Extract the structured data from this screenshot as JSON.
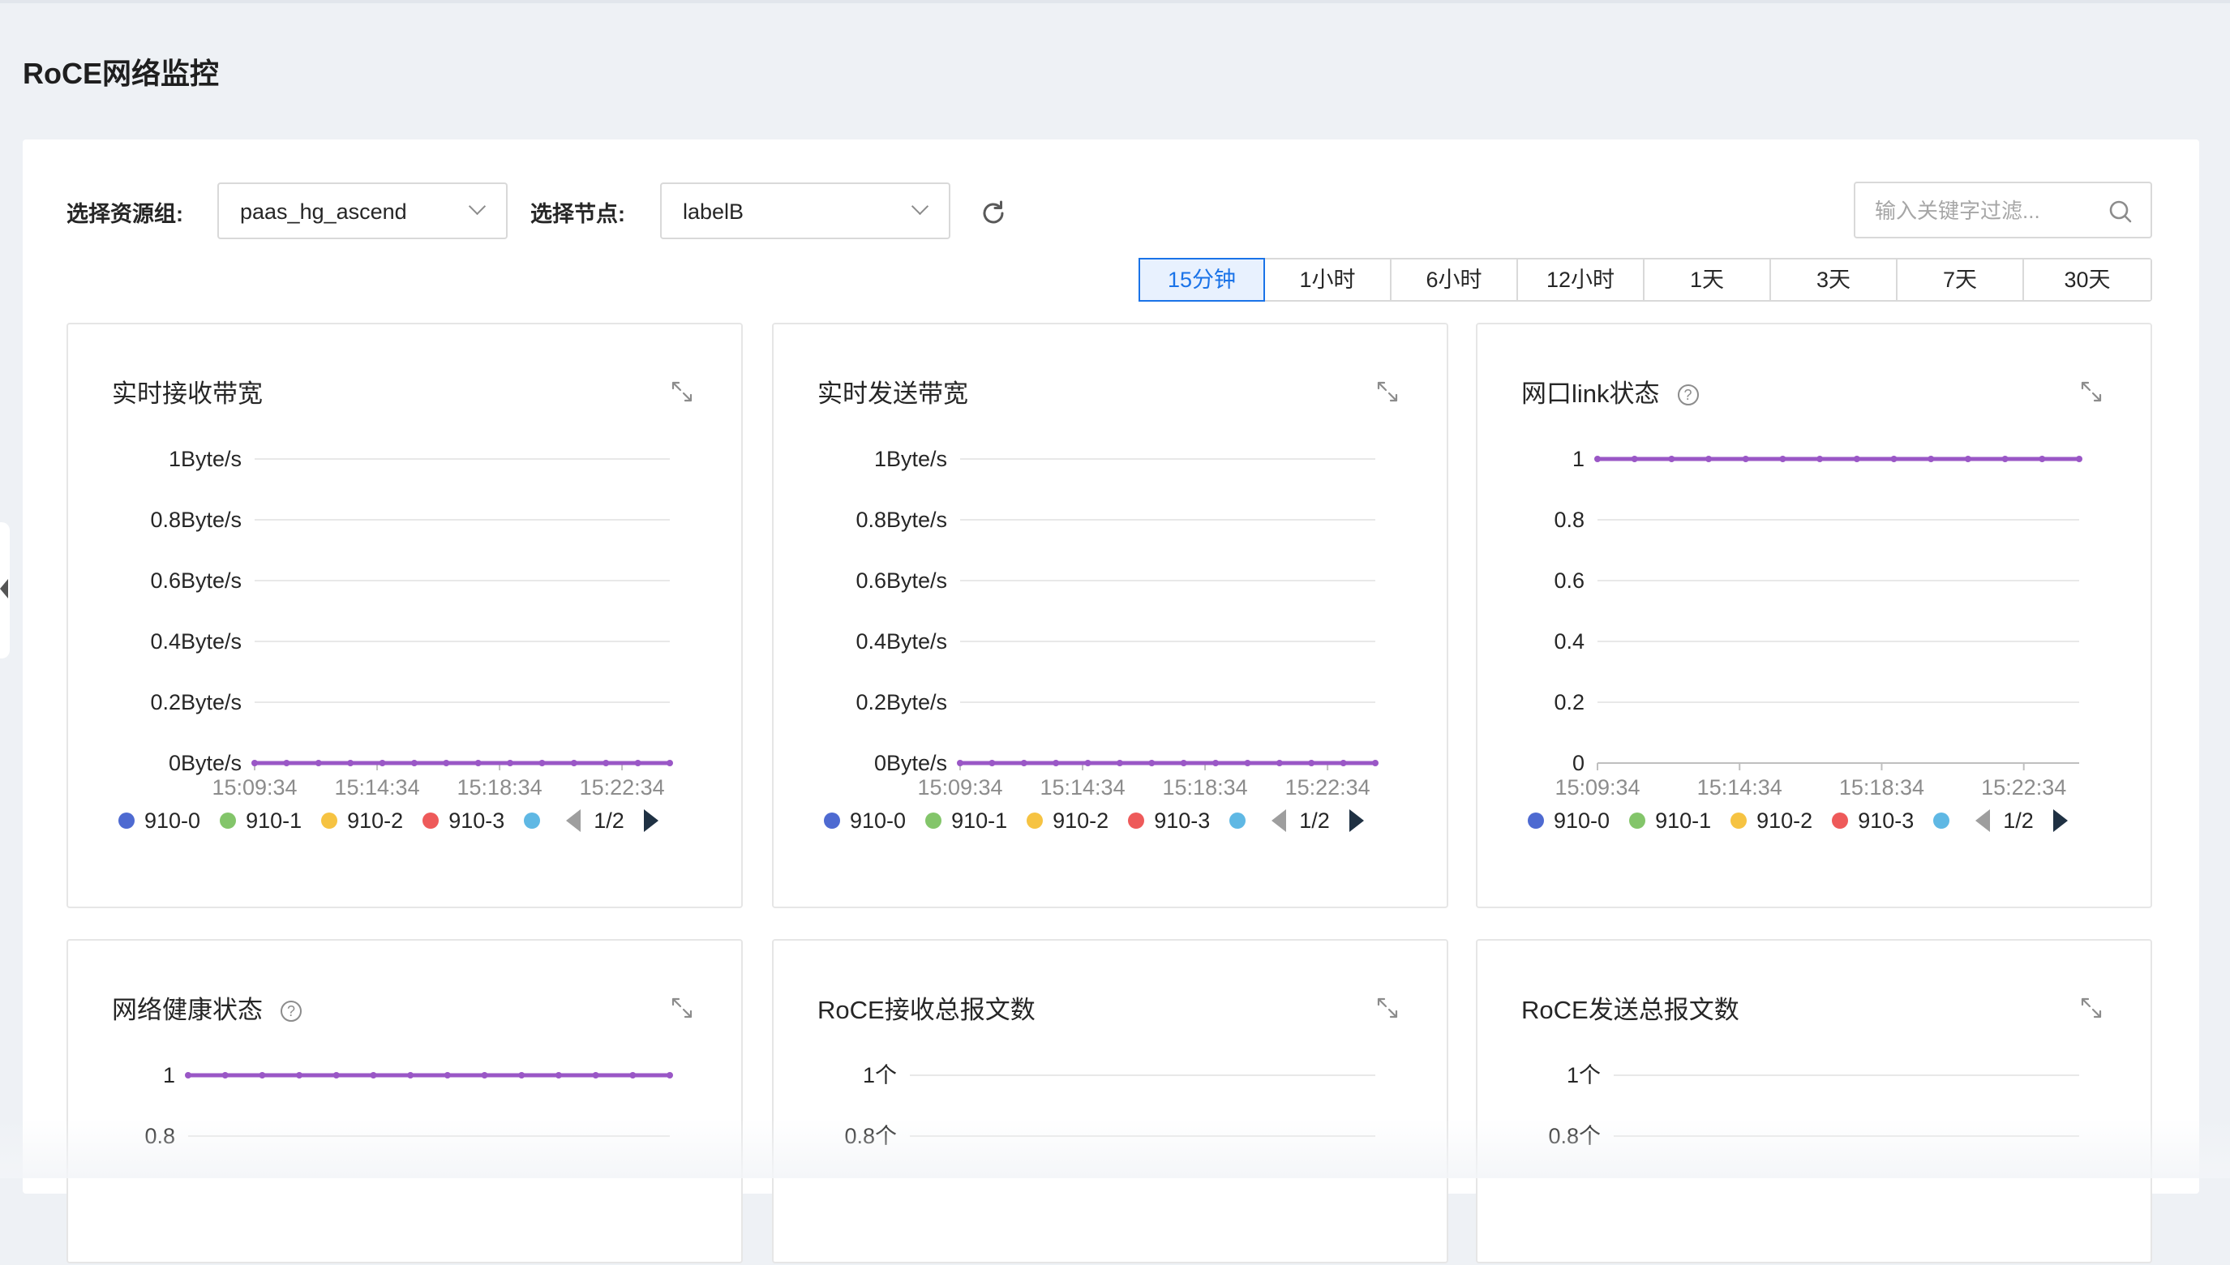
{
  "page": {
    "title": "RoCE网络监控"
  },
  "filters": {
    "resource_group_label": "选择资源组:",
    "resource_group_value": "paas_hg_ascend",
    "node_label": "选择节点:",
    "node_value": "labelB",
    "search_placeholder": "输入关键字过滤..."
  },
  "time_ranges": [
    "15分钟",
    "1小时",
    "6小时",
    "12小时",
    "1天",
    "3天",
    "7天",
    "30天"
  ],
  "selected_time_range": "15分钟",
  "legend": {
    "items": [
      {
        "name": "910-0",
        "color": "#4e6ad1"
      },
      {
        "name": "910-1",
        "color": "#83c56a"
      },
      {
        "name": "910-2",
        "color": "#f6c342"
      },
      {
        "name": "910-3",
        "color": "#ee5a5a"
      },
      {
        "name": "",
        "color": "#5fb8e4"
      }
    ],
    "page_indicator": "1/2"
  },
  "line_color": "#9a57c6",
  "panels": [
    {
      "title": "实时接收带宽",
      "has_help": false
    },
    {
      "title": "实时发送带宽",
      "has_help": false
    },
    {
      "title": "网口link状态",
      "has_help": true
    },
    {
      "title": "网络健康状态",
      "has_help": true
    },
    {
      "title": "RoCE接收总报文数",
      "has_help": false
    },
    {
      "title": "RoCE发送总报文数",
      "has_help": false
    }
  ],
  "chart_data": [
    {
      "type": "line",
      "title": "实时接收带宽",
      "y_tick_labels": [
        "0Byte/s",
        "0.2Byte/s",
        "0.4Byte/s",
        "0.6Byte/s",
        "0.8Byte/s",
        "1Byte/s"
      ],
      "ylim": [
        0,
        1
      ],
      "x_tick_labels": [
        "15:09:34",
        "15:14:34",
        "15:18:34",
        "15:22:34"
      ],
      "series_values": [
        0,
        0,
        0,
        0,
        0,
        0,
        0,
        0,
        0,
        0,
        0,
        0,
        0,
        0
      ],
      "grid": true
    },
    {
      "type": "line",
      "title": "实时发送带宽",
      "y_tick_labels": [
        "0Byte/s",
        "0.2Byte/s",
        "0.4Byte/s",
        "0.6Byte/s",
        "0.8Byte/s",
        "1Byte/s"
      ],
      "ylim": [
        0,
        1
      ],
      "x_tick_labels": [
        "15:09:34",
        "15:14:34",
        "15:18:34",
        "15:22:34"
      ],
      "series_values": [
        0,
        0,
        0,
        0,
        0,
        0,
        0,
        0,
        0,
        0,
        0,
        0,
        0,
        0
      ],
      "grid": true
    },
    {
      "type": "line",
      "title": "网口link状态",
      "y_tick_labels": [
        "0",
        "0.2",
        "0.4",
        "0.6",
        "0.8",
        "1"
      ],
      "ylim": [
        0,
        1
      ],
      "x_tick_labels": [
        "15:09:34",
        "15:14:34",
        "15:18:34",
        "15:22:34"
      ],
      "series_values": [
        1,
        1,
        1,
        1,
        1,
        1,
        1,
        1,
        1,
        1,
        1,
        1,
        1,
        1
      ],
      "grid": true
    },
    {
      "type": "line",
      "title": "网络健康状态",
      "y_tick_labels": [
        "0.8",
        "1"
      ],
      "ylim": [
        0,
        1
      ],
      "series_values": [
        1,
        1,
        1,
        1,
        1,
        1,
        1,
        1,
        1,
        1,
        1,
        1,
        1,
        1
      ],
      "grid": true
    },
    {
      "type": "line",
      "title": "RoCE接收总报文数",
      "y_tick_labels": [
        "0.8个",
        "1个"
      ],
      "ylim": [
        0,
        1
      ],
      "series_values": [],
      "grid": true
    },
    {
      "type": "line",
      "title": "RoCE发送总报文数",
      "y_tick_labels": [
        "0.8个",
        "1个"
      ],
      "ylim": [
        0,
        1
      ],
      "series_values": [],
      "grid": true
    }
  ]
}
